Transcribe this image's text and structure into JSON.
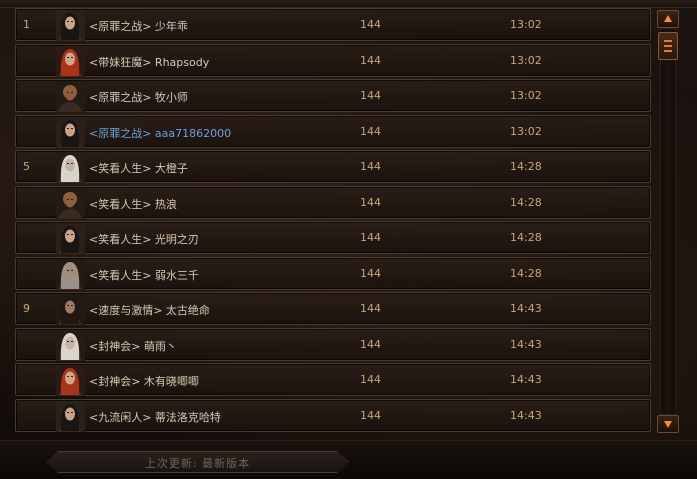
{
  "header": {
    "col_level": "",
    "col_time": ""
  },
  "rows": [
    {
      "rank": "1",
      "name": "<原罪之战> 少年乖",
      "level": "144",
      "time": "13:02",
      "portrait": "female-dark-hair-icon",
      "highlight": false
    },
    {
      "rank": "",
      "name": "<带妹狂魔> Rhapsody",
      "level": "144",
      "time": "13:02",
      "portrait": "female-red-hair-icon",
      "highlight": false
    },
    {
      "rank": "",
      "name": "<原罪之战> 牧小师",
      "level": "144",
      "time": "13:02",
      "portrait": "male-bald-icon",
      "highlight": false
    },
    {
      "rank": "",
      "name": "<原罪之战> aaa71862000",
      "level": "144",
      "time": "13:02",
      "portrait": "female-dark-hair-icon",
      "highlight": true
    },
    {
      "rank": "5",
      "name": "<笑看人生> 大橙子",
      "level": "144",
      "time": "14:28",
      "portrait": "female-white-hair-icon",
      "highlight": false
    },
    {
      "rank": "",
      "name": "<笑看人生> 热浪",
      "level": "144",
      "time": "14:28",
      "portrait": "male-bald-icon",
      "highlight": false
    },
    {
      "rank": "",
      "name": "<笑看人生> 光明之刃",
      "level": "144",
      "time": "14:28",
      "portrait": "female-dark-hair-icon",
      "highlight": false
    },
    {
      "rank": "",
      "name": "<笑看人生> 弱水三千",
      "level": "144",
      "time": "14:28",
      "portrait": "male-grey-hair-icon",
      "highlight": false
    },
    {
      "rank": "9",
      "name": "<速度与激情> 太古绝命",
      "level": "144",
      "time": "14:43",
      "portrait": "male-dark-hair-icon",
      "highlight": false
    },
    {
      "rank": "",
      "name": "<封神会> 萌雨丶",
      "level": "144",
      "time": "14:43",
      "portrait": "female-white-hair-icon",
      "highlight": false
    },
    {
      "rank": "",
      "name": "<封神会> 木有晓唧唧",
      "level": "144",
      "time": "14:43",
      "portrait": "female-red-hair-icon",
      "highlight": false
    },
    {
      "rank": "",
      "name": "<九流闲人> 蒂法洛克哈特",
      "level": "144",
      "time": "14:43",
      "portrait": "female-dark-hair-icon",
      "highlight": false
    }
  ],
  "scrollbar": {
    "up_icon": "arrow-up-icon",
    "down_icon": "arrow-down-icon"
  },
  "footer": {
    "text": "上次更新: 最新版本"
  },
  "colors": {
    "rank": "#c9a773",
    "name": "#d6c9b2",
    "name_highlight": "#6f9fd8",
    "accent": "#ff8a3a"
  }
}
